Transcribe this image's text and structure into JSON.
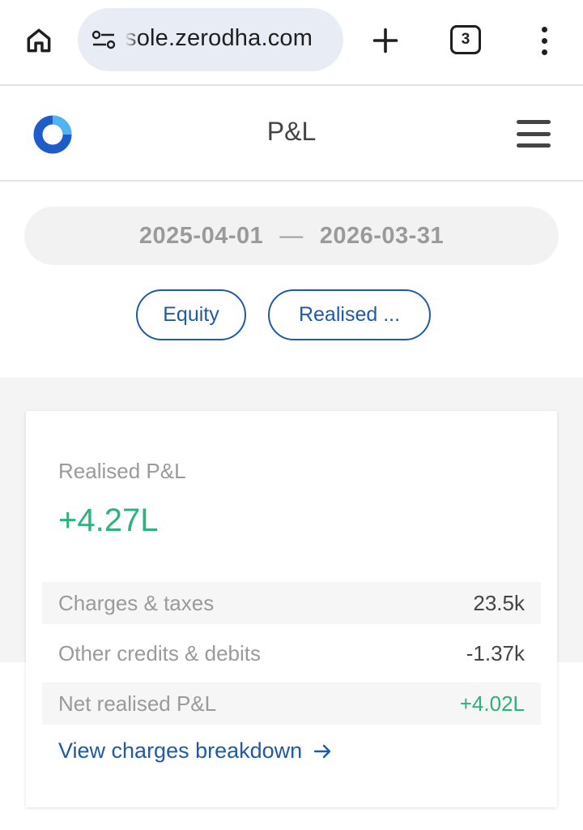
{
  "browser": {
    "url": "sole.zerodha.com",
    "tab_count": "3"
  },
  "header": {
    "title": "P&L"
  },
  "filters": {
    "date_from": "2025-04-01",
    "date_separator": "—",
    "date_to": "2026-03-31",
    "segment": "Equity",
    "pnl_type": "Realised ..."
  },
  "summary": {
    "realised_label": "Realised P&L",
    "realised_value": "+4.27L",
    "rows": [
      {
        "label": "Charges & taxes",
        "value": "23.5k"
      },
      {
        "label": "Other credits & debits",
        "value": "-1.37k"
      },
      {
        "label": "Net realised P&L",
        "value": "+4.02L"
      }
    ],
    "breakdown_link": "View charges breakdown"
  },
  "colors": {
    "accent_blue": "#1f5aa6",
    "profit_green": "#2ab37a",
    "logo_blue": "#1e5dc9",
    "logo_light": "#4fb4f0"
  }
}
